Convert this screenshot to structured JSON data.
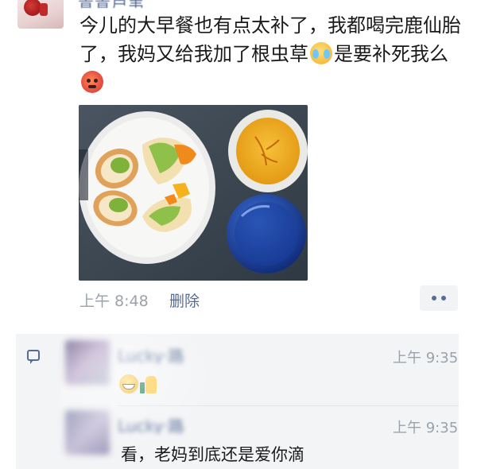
{
  "post": {
    "author_name": "青青芦苇",
    "text_1": "今儿的大早餐也有点太补了，我都喝完鹿仙胎了，我妈又给我加了根虫草",
    "text_2": "是要补死我么",
    "emoji_1": "loudly-crying-face-icon",
    "emoji_2": "angry-face-icon",
    "photo_alt": "breakfast photo",
    "time": "上午 8:48",
    "delete_label": "删除",
    "more_icon": "more-dots-icon"
  },
  "comments": [
    {
      "author_name": "Lucky·路",
      "time": "上午 9:35",
      "text": "",
      "emojis": [
        "grinning-face-icon",
        "thumbs-up-icon"
      ]
    },
    {
      "author_name": "Lucky·路",
      "time": "上午 9:35",
      "text": "看，老妈到底还是爱你滴"
    }
  ],
  "colors": {
    "link": "#576b95",
    "meta": "#9aa3ab",
    "comment_bg": "#f3f4f6"
  }
}
